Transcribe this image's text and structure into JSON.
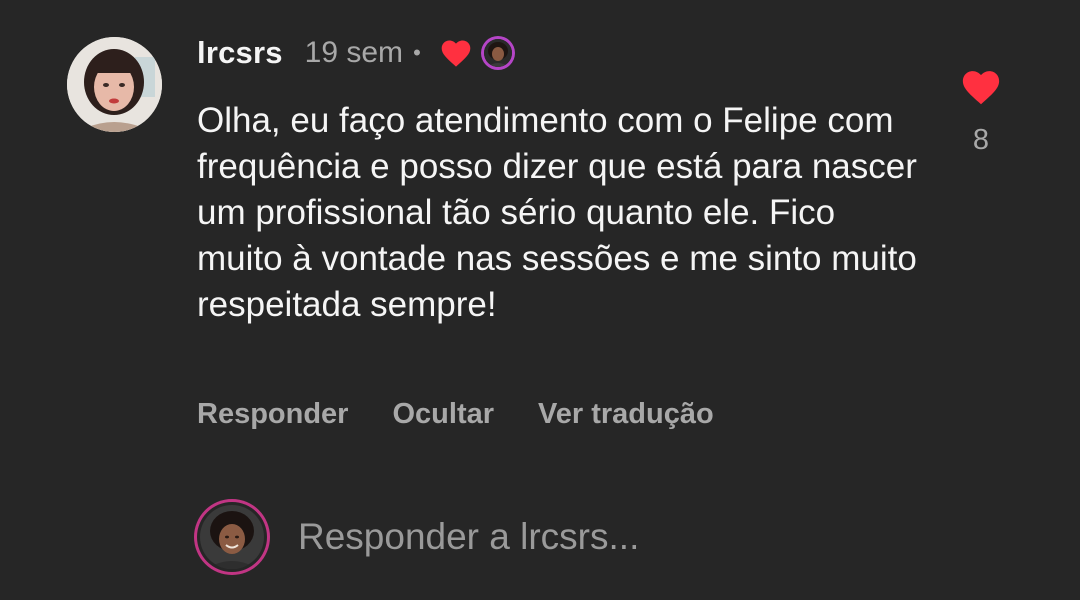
{
  "comment": {
    "username": "lrcsrs",
    "time": "19 sem",
    "separator": "•",
    "text": "Olha, eu faço atendimento com o Felipe com frequência e posso dizer que está para nascer um profissional tão sério quanto ele. Fico muito à vontade nas sessões e me sinto muito respeitada sempre!",
    "like_count": "8",
    "actions": {
      "reply": "Responder",
      "hide": "Ocultar",
      "translate": "Ver tradução"
    }
  },
  "reply_bar": {
    "placeholder": "Responder a lrcsrs..."
  },
  "icons": {
    "like": "heart-icon",
    "creator_liked": "heart-icon",
    "creator_avatar": "avatar"
  },
  "colors": {
    "background": "#262626",
    "heart": "#ff3040",
    "muted_text": "#a8a8a8",
    "story_ring": "#c13584"
  }
}
